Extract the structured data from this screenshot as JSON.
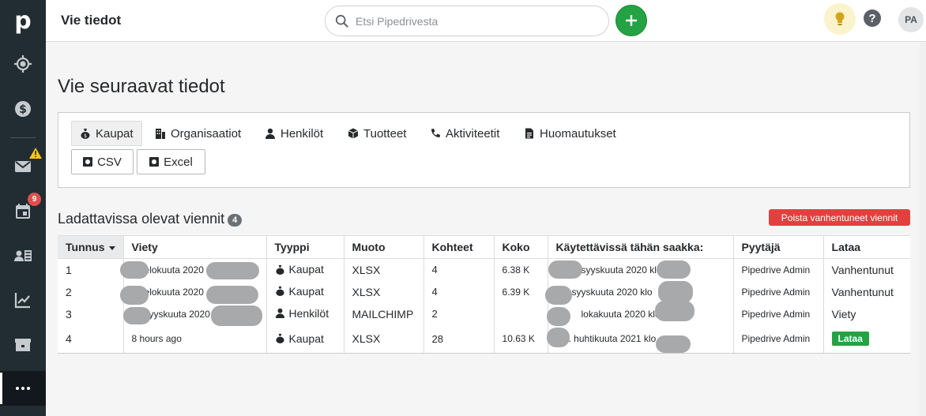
{
  "app": {
    "logo": "p",
    "page_header": "Vie tiedot",
    "search_placeholder": "Etsi Pipedrivesta",
    "avatar_initials": "PA",
    "help_glyph": "?",
    "activities_badge": "9",
    "brand_green": "#25a243",
    "alert_red": "#e2403f"
  },
  "rail": {
    "icons": [
      "target-icon",
      "dollar-icon",
      "mail-icon",
      "calendar-icon",
      "contacts-icon",
      "chart-icon",
      "store-icon",
      "more-icon"
    ]
  },
  "main": {
    "title": "Vie seuraavat tiedot",
    "tabs": [
      {
        "label": "Kaupat",
        "icon": "moneybag-icon"
      },
      {
        "label": "Organisaatiot",
        "icon": "building-icon"
      },
      {
        "label": "Henkilöt",
        "icon": "person-icon"
      },
      {
        "label": "Tuotteet",
        "icon": "box-icon"
      },
      {
        "label": "Aktiviteetit",
        "icon": "phone-icon"
      },
      {
        "label": "Huomautukset",
        "icon": "note-icon"
      }
    ],
    "formats": [
      "CSV",
      "Excel"
    ],
    "downloads_title": "Ladattavissa olevat viennit",
    "downloads_count": "4",
    "delete_expired": "Poista vanhentuneet viennit"
  },
  "table": {
    "headers": [
      "Tunnus",
      "Viety",
      "Tyyppi",
      "Muoto",
      "Kohteet",
      "Koko",
      "Käytettävissä tähän saakka:",
      "Pyytäjä",
      "Lataa"
    ],
    "rows": [
      {
        "id": "1",
        "exported": "elokuuta 2020",
        "type": "Kaupat",
        "format": "XLSX",
        "items": "4",
        "size": "6.38 K",
        "available": "syyskuuta 2020 klo",
        "requester": "Pipedrive Admin",
        "status": "Vanhentunut"
      },
      {
        "id": "2",
        "exported": "elokuuta 2020",
        "type": "Kaupat",
        "format": "XLSX",
        "items": "4",
        "size": "6.39 K",
        "available": "syyskuuta 2020 klo",
        "requester": "Pipedrive Admin",
        "status": "Vanhentunut"
      },
      {
        "id": "3",
        "exported": "syyskuuta 2020",
        "type": "Henkilöt",
        "format": "MAILCHIMP",
        "items": "2",
        "size": "",
        "available": "lokakuuta 2020 klo",
        "requester": "Pipedrive Admin",
        "status": "Viety"
      },
      {
        "id": "4",
        "exported": "8 hours ago",
        "type": "Kaupat",
        "format": "XLSX",
        "items": "28",
        "size": "10.63 K",
        "available": ". huhtikuuta 2021 klo",
        "requester": "Pipedrive Admin",
        "status": "Lataa"
      }
    ]
  }
}
